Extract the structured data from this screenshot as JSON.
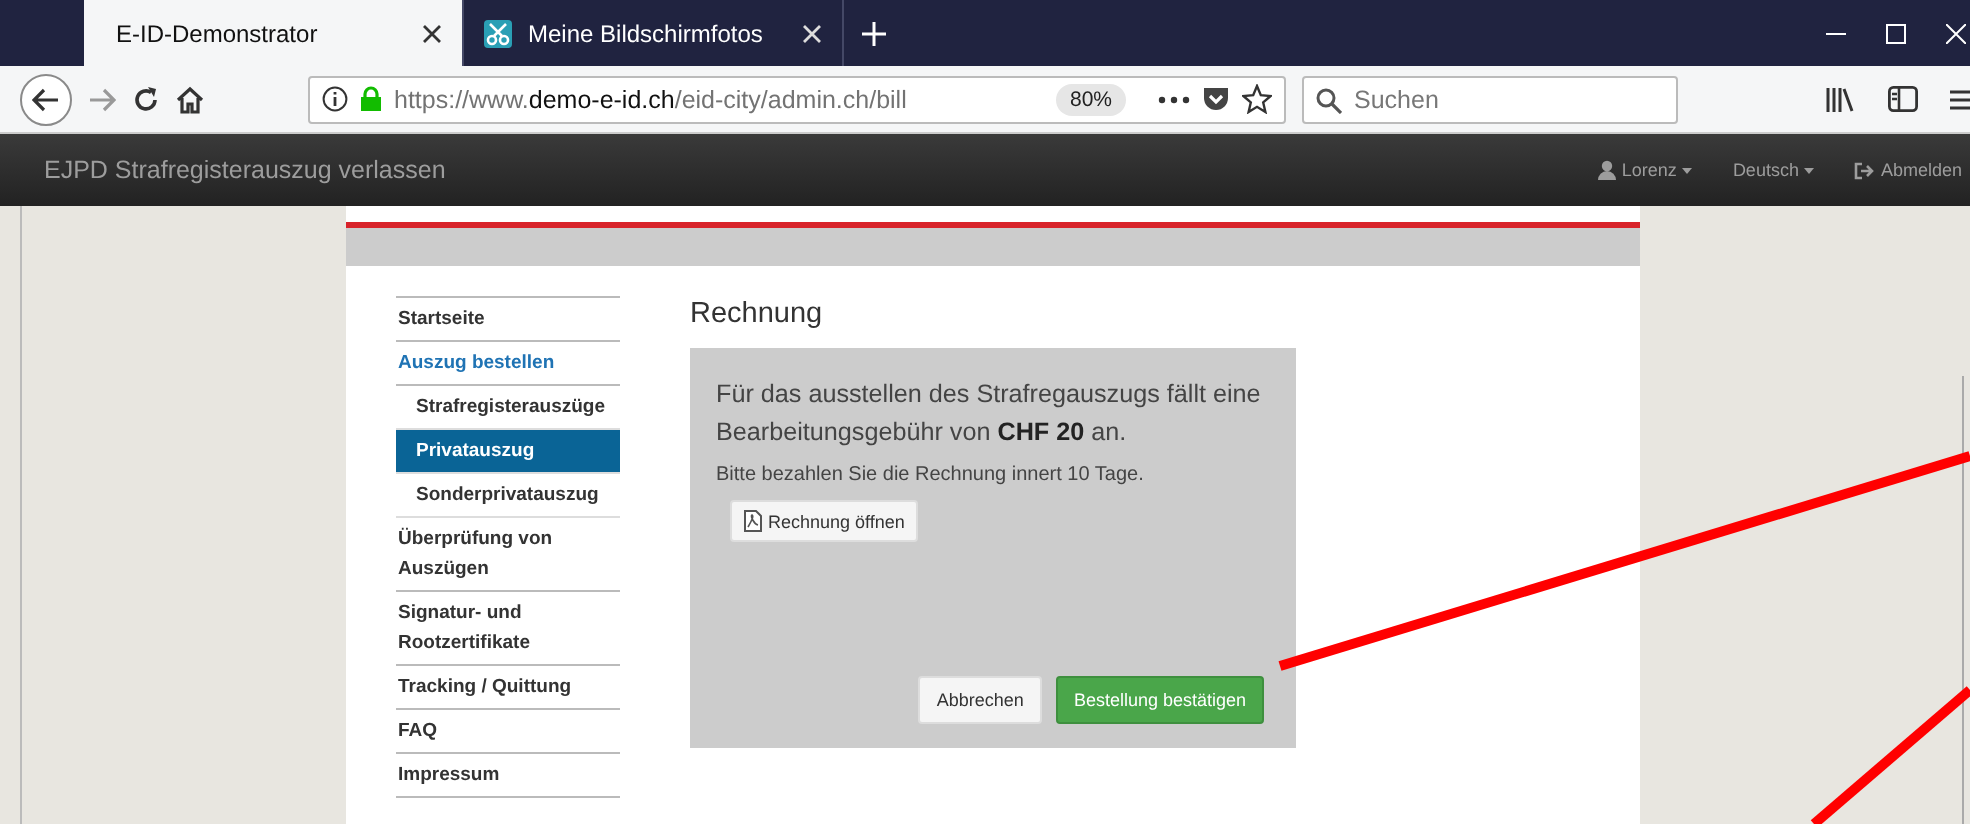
{
  "tabs": [
    {
      "title": "E-ID-Demonstrator",
      "selected": true
    },
    {
      "title": "Meine Bildschirmfotos",
      "selected": false
    }
  ],
  "toolbar": {
    "url": "https://www.**demo-e-id.ch**/eid-city/admin.ch/bill",
    "zoom": "80%",
    "search": {
      "placeholder": "Suchen"
    }
  },
  "navbar": {
    "brand": "EJPD Strafregisterauszug verlassen",
    "user": "Lorenz",
    "language": "Deutsch",
    "logout": "Abmelden"
  },
  "sidebar": {
    "items": [
      {
        "label": "Startseite",
        "active": false,
        "selected": false
      },
      {
        "label": "Auszug bestellen",
        "active": true,
        "selected": false,
        "children": [
          {
            "label": "Strafregisterauszüge",
            "selected": false
          },
          {
            "label": "Privatauszug",
            "selected": true
          },
          {
            "label": "Sonderprivatauszug",
            "selected": false
          }
        ]
      },
      {
        "label": "Überprüfung von Auszügen",
        "active": false,
        "selected": false
      },
      {
        "label": "Signatur- und Rootzertifikate",
        "active": false,
        "selected": false
      },
      {
        "label": "Tracking / Quittung",
        "active": false,
        "selected": false
      },
      {
        "label": "FAQ",
        "active": false,
        "selected": false
      },
      {
        "label": "Impressum",
        "active": false,
        "selected": false
      }
    ]
  },
  "content": {
    "heading": "Rechnung",
    "fee_text": "Für das ausstellen des Strafregauszugs fällt eine Bearbeitungsgebühr von **CHF 20** an.",
    "payment_note": "Bitte bezahlen Sie die Rechnung innert 10 Tage.",
    "open_invoice_button": "Rechnung öffnen",
    "buttons": [
      {
        "label": "Abbrechen",
        "kind": "default"
      },
      {
        "label": "Bestellung bestätigen",
        "kind": "primary"
      }
    ]
  }
}
